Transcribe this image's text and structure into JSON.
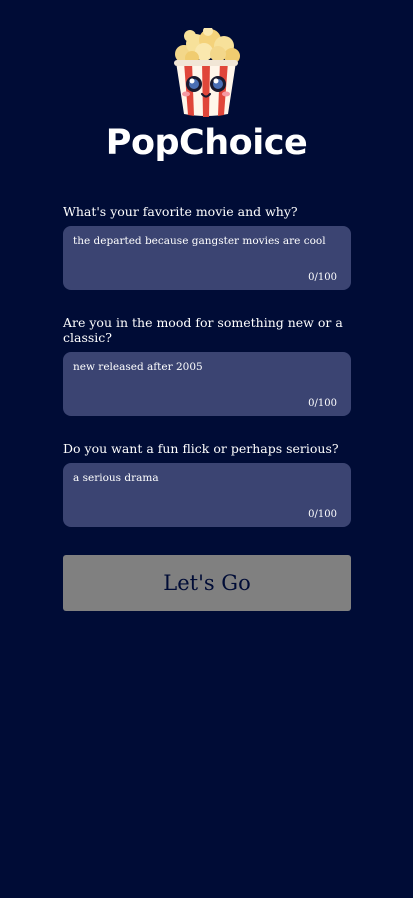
{
  "brand": {
    "name": "PopChoice",
    "logo": "popcorn-bucket-icon"
  },
  "questions": [
    {
      "label": "What's your favorite movie and why?",
      "answer": "the departed because gangster movies are cool",
      "counter": "0/100"
    },
    {
      "label": "Are you in the mood for something new or a classic?",
      "answer": "new released after 2005",
      "counter": "0/100"
    },
    {
      "label": "Do you want a fun flick or perhaps serious?",
      "answer": "a serious drama",
      "counter": "0/100"
    }
  ],
  "submit": {
    "label": "Let's Go"
  },
  "colors": {
    "background": "#000c36",
    "input_background": "#3b4472",
    "button_background": "#808080",
    "button_text": "#000c36"
  }
}
